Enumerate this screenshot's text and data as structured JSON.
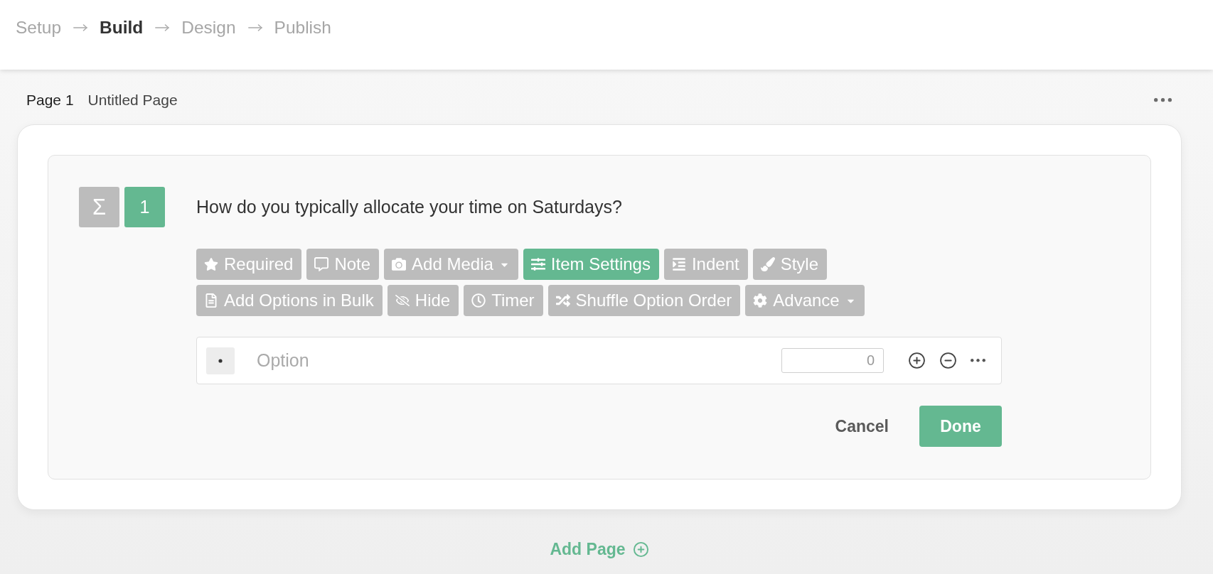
{
  "steps": [
    {
      "label": "Setup",
      "selected": false
    },
    {
      "label": "Build",
      "selected": true
    },
    {
      "label": "Design",
      "selected": false
    },
    {
      "label": "Publish",
      "selected": false
    }
  ],
  "page": {
    "number": "Page 1",
    "title": "Untitled Page"
  },
  "question": {
    "type_symbol": "Σ",
    "number": "1",
    "text": "How do you typically allocate your time on Saturdays?",
    "toolbar_rows": [
      [
        {
          "label": "Required",
          "kind": "star",
          "selected": false,
          "dropdown": false
        },
        {
          "label": "Note",
          "kind": "comment",
          "selected": false,
          "dropdown": false
        },
        {
          "label": "Add Media",
          "kind": "camera",
          "selected": false,
          "dropdown": true
        },
        {
          "label": "Item Settings",
          "kind": "sliders",
          "selected": true,
          "dropdown": false
        },
        {
          "label": "Indent",
          "kind": "indent",
          "selected": false,
          "dropdown": false
        },
        {
          "label": "Style",
          "kind": "brush",
          "selected": false,
          "dropdown": false
        }
      ],
      [
        {
          "label": "Add Options in Bulk",
          "kind": "file",
          "selected": false,
          "dropdown": false
        },
        {
          "label": "Hide",
          "kind": "eye",
          "selected": false,
          "dropdown": false
        },
        {
          "label": "Timer",
          "kind": "clock",
          "selected": false,
          "dropdown": false
        },
        {
          "label": "Shuffle Option Order",
          "kind": "shuffle",
          "selected": false,
          "dropdown": false
        },
        {
          "label": "Advance",
          "kind": "gear",
          "selected": false,
          "dropdown": true
        }
      ]
    ],
    "options": [
      {
        "placeholder": "Option",
        "score": {
          "placeholder": "0"
        }
      }
    ],
    "actions": {
      "cancel": "Cancel",
      "done": "Done"
    }
  },
  "add_page": "Add Page"
}
